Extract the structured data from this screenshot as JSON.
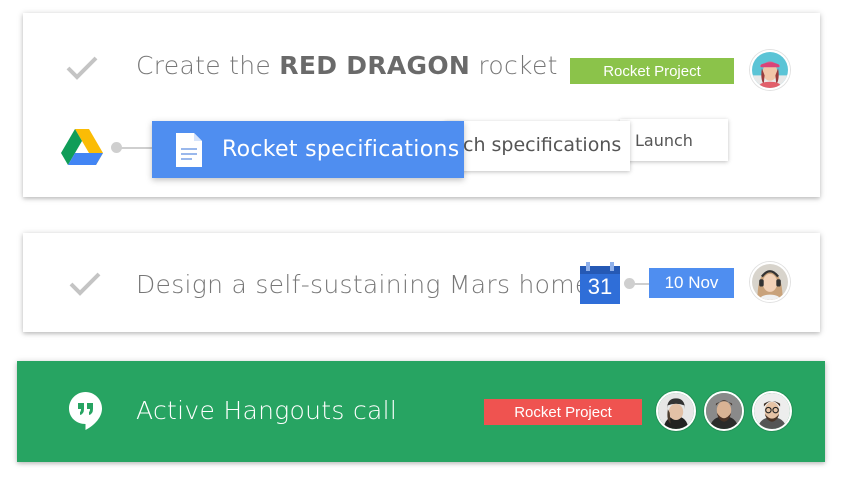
{
  "tasks": [
    {
      "text_prefix": "Create the ",
      "text_bold": "RED DRAGON",
      "text_suffix": " rocket",
      "tag": "Rocket Project",
      "tag_color": "#8bc34a",
      "avatar": "woman-with-cap-avatar",
      "attachments": {
        "source_icon": "google-drive-icon",
        "active_doc": "Rocket specifications",
        "active_doc_icon": "document-icon",
        "background_doc_1": "ch specifications",
        "background_doc_2": "Launch"
      }
    },
    {
      "text": "Design a self-sustaining Mars home",
      "calendar_day": "31",
      "calendar_icon": "google-calendar-icon",
      "date_tag": "10 Nov",
      "date_tag_color": "#4f8ef0",
      "avatar": "woman-with-headphones-avatar"
    }
  ],
  "hangouts": {
    "icon": "hangouts-icon",
    "text": "Active Hangouts call",
    "background": "#27a462",
    "tag": "Rocket Project",
    "tag_color": "#ef5350",
    "participants": [
      "participant-1-avatar",
      "participant-2-avatar",
      "participant-3-avatar"
    ]
  }
}
